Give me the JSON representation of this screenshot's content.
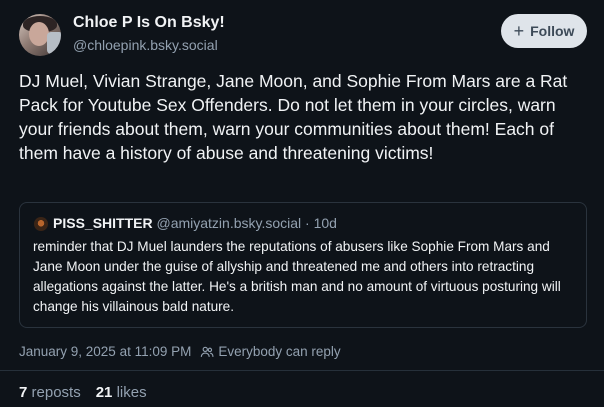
{
  "author": {
    "display_name": "Chloe P Is On Bsky!",
    "handle": "@chloepink.bsky.social"
  },
  "follow_button": {
    "icon": "plus-icon",
    "label": "Follow"
  },
  "post": {
    "text": "DJ Muel, Vivian Strange, Jane Moon, and Sophie From Mars are a Rat Pack for Youtube Sex Offenders. Do not let them in your circles, warn your friends about them, warn your communities about them! Each of them have a history of abuse and threatening victims!"
  },
  "quote": {
    "author_name": "PISS_SHITTER",
    "author_handle": "@amiyatzin.bsky.social",
    "separator": "·",
    "age": "10d",
    "text": "reminder that DJ Muel launders the reputations of abusers like Sophie From Mars and Jane Moon under the guise of allyship and threatened me and others into retracting allegations against the latter. He's a british man and no amount of virtuous posturing will change his villainous bald nature."
  },
  "meta": {
    "timestamp": "January 9, 2025 at 11:09 PM",
    "reply_setting": "Everybody can reply",
    "reply_icon": "people-icon"
  },
  "stats": {
    "reposts_count": "7",
    "reposts_label": "reposts",
    "likes_count": "21",
    "likes_label": "likes"
  },
  "colors": {
    "background": "#0e1319",
    "text": "#f1f3f5",
    "muted": "#93a1b0",
    "border": "#2a333d",
    "follow_bg": "#dfe4ea"
  }
}
